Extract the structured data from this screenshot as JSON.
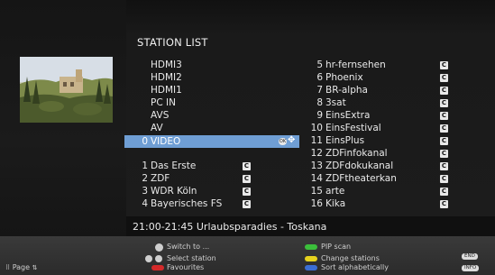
{
  "title": "STATION LIST",
  "left": [
    {
      "num": "",
      "name": "HDMI3"
    },
    {
      "num": "",
      "name": "HDMI2"
    },
    {
      "num": "",
      "name": "HDMI1"
    },
    {
      "num": "",
      "name": "PC IN"
    },
    {
      "num": "",
      "name": "AVS"
    },
    {
      "num": "",
      "name": "AV"
    },
    {
      "num": "0",
      "name": "VIDEO"
    },
    {
      "num": "1",
      "name": "Das Erste"
    },
    {
      "num": "2",
      "name": "ZDF"
    },
    {
      "num": "3",
      "name": "WDR Köln"
    },
    {
      "num": "4",
      "name": "Bayerisches FS"
    }
  ],
  "right": [
    {
      "num": "5",
      "name": "hr-fernsehen"
    },
    {
      "num": "6",
      "name": "Phoenix"
    },
    {
      "num": "7",
      "name": "BR-alpha"
    },
    {
      "num": "8",
      "name": "3sat"
    },
    {
      "num": "9",
      "name": "EinsExtra"
    },
    {
      "num": "10",
      "name": "EinsFestival"
    },
    {
      "num": "11",
      "name": "EinsPlus"
    },
    {
      "num": "12",
      "name": "ZDFinfokanal"
    },
    {
      "num": "13",
      "name": "ZDFdokukanal"
    },
    {
      "num": "14",
      "name": "ZDFtheaterkan"
    },
    {
      "num": "15",
      "name": "arte"
    },
    {
      "num": "16",
      "name": "Kika"
    }
  ],
  "program": "21:00-21:45 Urlaubsparadies - Toskana",
  "hints": {
    "page": "Page",
    "switch_to": "Switch to ...",
    "select_station": "Select station",
    "favourites": "Favourites",
    "pip_scan": "PIP scan",
    "change_stations": "Change stations",
    "sort": "Sort alphabetically",
    "end": "END",
    "info": "INFO"
  },
  "colors": {
    "selection": "#6f9ed4",
    "red": "#d42a2a",
    "green": "#3bbf3b",
    "yellow": "#e6d21e",
    "blue": "#3b6ed4"
  },
  "selected_station": "0 VIDEO"
}
